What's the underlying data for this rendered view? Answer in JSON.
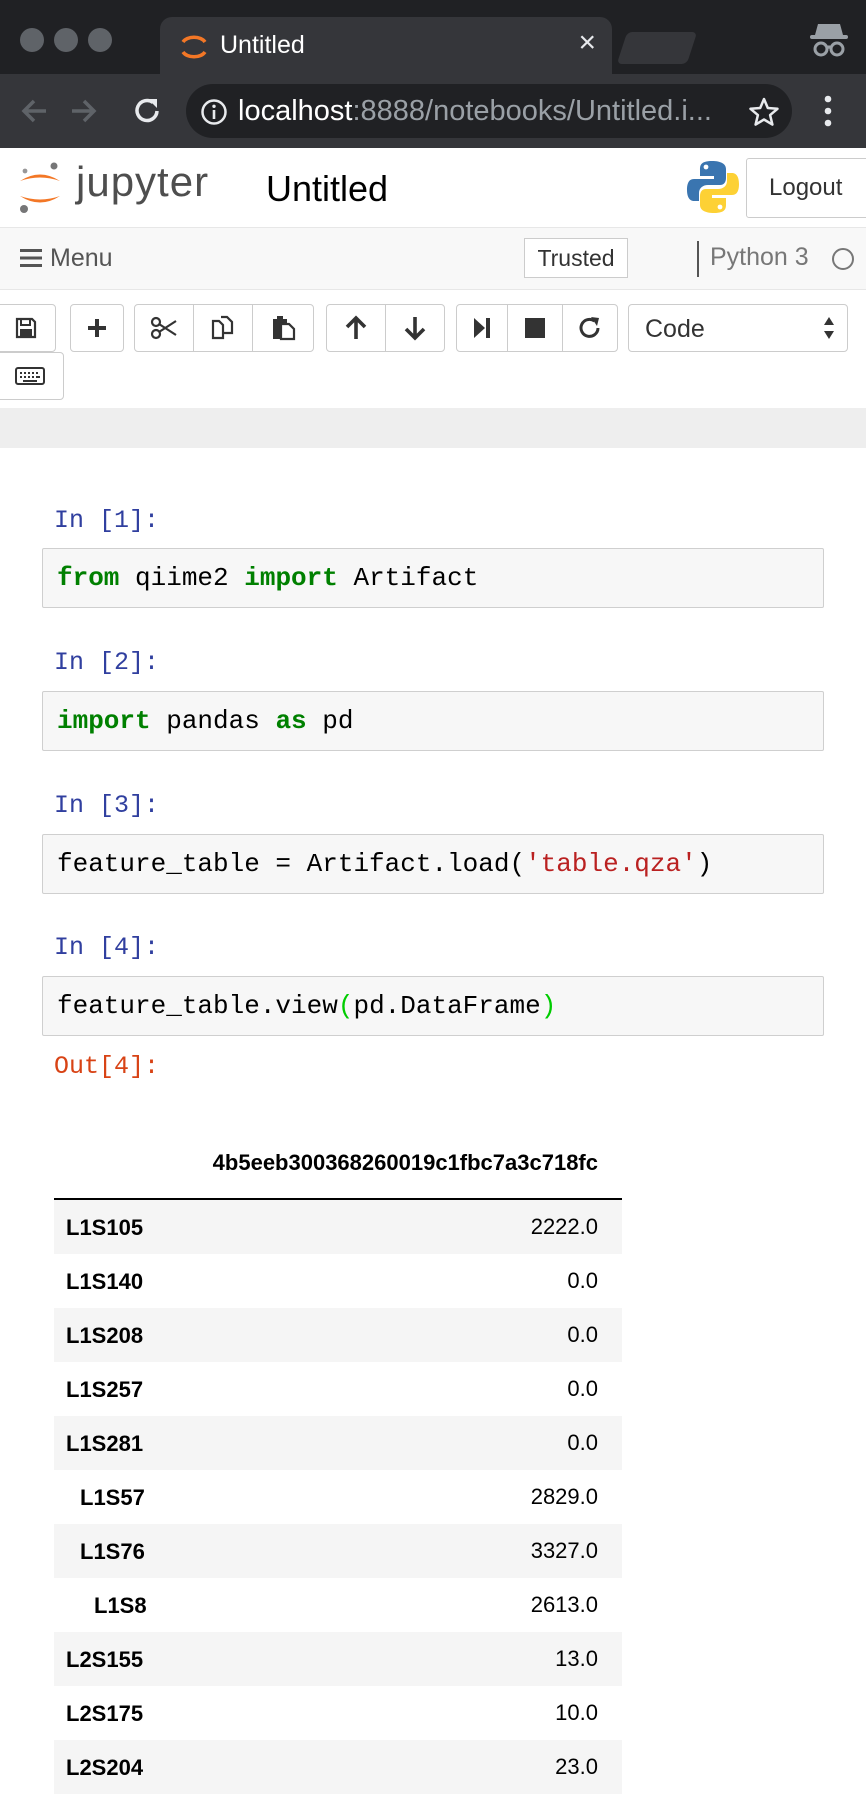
{
  "browser": {
    "tab_title": "Untitled",
    "tab_close": "×",
    "url_host": "localhost",
    "url_rest": ":8888/notebooks/Untitled.i..."
  },
  "jupyter": {
    "wordmark": "jupyter",
    "notebook_name": "Untitled",
    "logout_label": "Logout",
    "menu_label": "Menu",
    "trusted_label": "Trusted",
    "kernel_name": "Python 3",
    "cell_type": "Code",
    "toolbar_icons": [
      "save-icon",
      "plus-icon",
      "scissors-icon",
      "copy-icon",
      "paste-icon",
      "arrow-up-icon",
      "arrow-down-icon",
      "step-forward-icon",
      "stop-icon",
      "restart-icon",
      "keyboard-icon"
    ]
  },
  "cells": [
    {
      "prompt": "In [1]:",
      "code": [
        {
          "t": "from",
          "c": "kw"
        },
        {
          "t": " qiime2 "
        },
        {
          "t": "import",
          "c": "kw"
        },
        {
          "t": " Artifact"
        }
      ]
    },
    {
      "prompt": "In [2]:",
      "code": [
        {
          "t": "import",
          "c": "kw"
        },
        {
          "t": " pandas "
        },
        {
          "t": "as",
          "c": "kw"
        },
        {
          "t": " pd"
        }
      ]
    },
    {
      "prompt": "In [3]:",
      "code": [
        {
          "t": "feature_table = Artifact.load("
        },
        {
          "t": "'table.qza'",
          "c": "str"
        },
        {
          "t": ")"
        }
      ]
    },
    {
      "prompt": "In [4]:",
      "code": [
        {
          "t": "feature_table.view"
        },
        {
          "t": "(",
          "c": "paren"
        },
        {
          "t": "pd.DataFrame"
        },
        {
          "t": ")",
          "c": "paren"
        }
      ]
    }
  ],
  "output": {
    "prompt": "Out[4]:",
    "column_header": "4b5eeb300368260019c1fbc7a3c718fc",
    "rows": [
      {
        "index": "L1S105",
        "value": "2222.0"
      },
      {
        "index": "L1S140",
        "value": "0.0"
      },
      {
        "index": "L1S208",
        "value": "0.0"
      },
      {
        "index": "L1S257",
        "value": "0.0"
      },
      {
        "index": "L1S281",
        "value": "0.0"
      },
      {
        "index": "L1S57",
        "value": "2829.0"
      },
      {
        "index": "L1S76",
        "value": "3327.0"
      },
      {
        "index": "L1S8",
        "value": "2613.0"
      },
      {
        "index": "L2S155",
        "value": "13.0"
      },
      {
        "index": "L2S175",
        "value": "10.0"
      },
      {
        "index": "L2S204",
        "value": "23.0"
      }
    ]
  },
  "colors": {
    "chrome_dark": "#202124",
    "chrome_tab": "#35363a",
    "jupyter_orange": "#f37726",
    "prompt_in": "#303f9f",
    "prompt_out": "#d84315",
    "keyword": "#008000",
    "string": "#ba2121"
  }
}
